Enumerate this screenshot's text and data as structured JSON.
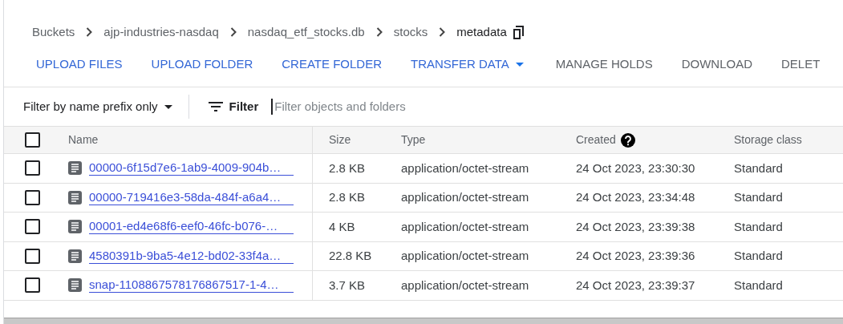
{
  "breadcrumbs": [
    "Buckets",
    "ajp-industries-nasdaq",
    "nasdaq_etf_stocks.db",
    "stocks",
    "metadata"
  ],
  "toolbar": [
    {
      "label": "UPLOAD FILES",
      "disabled": false,
      "kind": "button"
    },
    {
      "label": "UPLOAD FOLDER",
      "disabled": false,
      "kind": "button"
    },
    {
      "label": "CREATE FOLDER",
      "disabled": false,
      "kind": "button"
    },
    {
      "label": "TRANSFER DATA",
      "disabled": false,
      "kind": "dropdown"
    },
    {
      "label": "MANAGE HOLDS",
      "disabled": true,
      "kind": "button"
    },
    {
      "label": "DOWNLOAD",
      "disabled": true,
      "kind": "button"
    },
    {
      "label": "DELET",
      "disabled": true,
      "kind": "button"
    }
  ],
  "filter": {
    "mode": "Filter by name prefix only",
    "button": "Filter",
    "placeholder": "Filter objects and folders"
  },
  "table": {
    "all_checked": false,
    "columns": [
      "Name",
      "Size",
      "Type",
      "Created",
      "Storage class"
    ],
    "rows": [
      {
        "checked": false,
        "name": "00000-6f15d7e6-1ab9-4009-904b…",
        "size": "2.8 KB",
        "type": "application/octet-stream",
        "created": "24 Oct 2023, 23:30:30",
        "storage": "Standard"
      },
      {
        "checked": false,
        "name": "00000-719416e3-58da-484f-a6a4…",
        "size": "2.8 KB",
        "type": "application/octet-stream",
        "created": "24 Oct 2023, 23:34:48",
        "storage": "Standard"
      },
      {
        "checked": false,
        "name": "00001-ed4e68f6-eef0-46fc-b076-…",
        "size": "4 KB",
        "type": "application/octet-stream",
        "created": "24 Oct 2023, 23:39:38",
        "storage": "Standard"
      },
      {
        "checked": false,
        "name": "4580391b-9ba5-4e12-bd02-33f4a…",
        "size": "22.8 KB",
        "type": "application/octet-stream",
        "created": "24 Oct 2023, 23:39:36",
        "storage": "Standard"
      },
      {
        "checked": false,
        "name": "snap-1108867578176867517-1-4…",
        "size": "3.7 KB",
        "type": "application/octet-stream",
        "created": "24 Oct 2023, 23:39:37",
        "storage": "Standard"
      }
    ]
  }
}
